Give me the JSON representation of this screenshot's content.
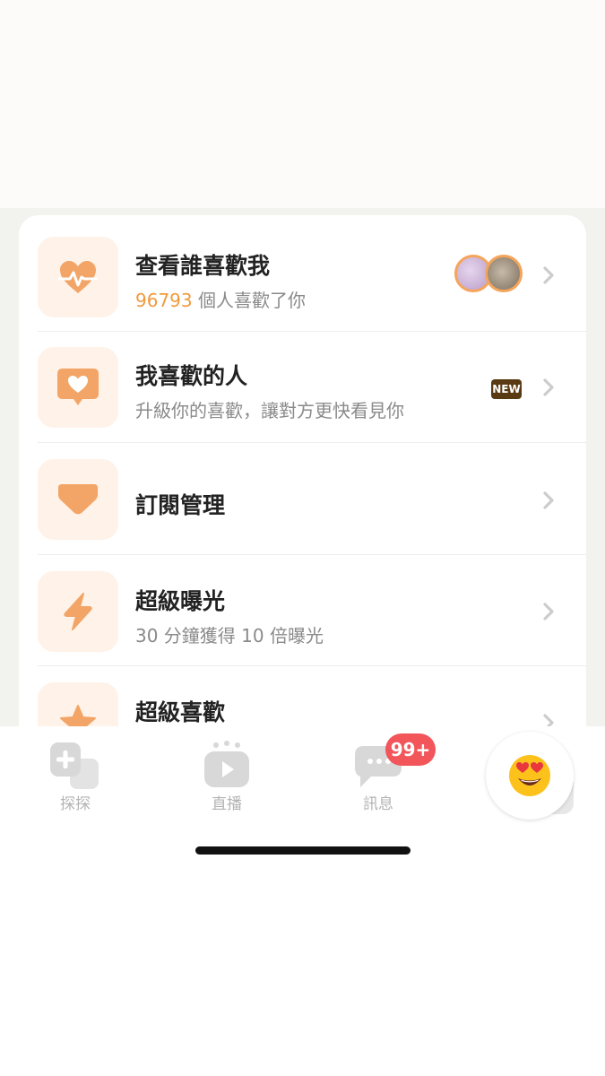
{
  "menu": {
    "items": [
      {
        "title": "查看誰喜歡我",
        "count": "96793",
        "sub_suffix": "個人喜歡了你",
        "icon": "heart-pulse-icon"
      },
      {
        "title": "我喜歡的人",
        "sub": "升級你的喜歡，讓對方更快看見你",
        "badge": "NEW",
        "icon": "heart-message-icon"
      },
      {
        "title": "訂閱管理",
        "icon": "diamond-icon"
      },
      {
        "title": "超級曝光",
        "sub": "30 分鐘獲得 10 倍曝光",
        "icon": "lightning-icon"
      },
      {
        "title": "超級喜歡",
        "icon": "star-icon"
      }
    ]
  },
  "tabbar": {
    "tabs": [
      {
        "label": "探探",
        "icon": "cards-icon"
      },
      {
        "label": "直播",
        "icon": "tv-play-icon"
      },
      {
        "label": "訊息",
        "icon": "chat-bubble-icon"
      }
    ],
    "message_badge": "99+",
    "profile_emoji": "😍"
  },
  "colors": {
    "accent": "#f09a3e",
    "icon_bg": "#fff2e8",
    "icon_fill": "#f2a566",
    "badge_red": "#f2555a",
    "new_badge_bg": "#5a3a12"
  }
}
